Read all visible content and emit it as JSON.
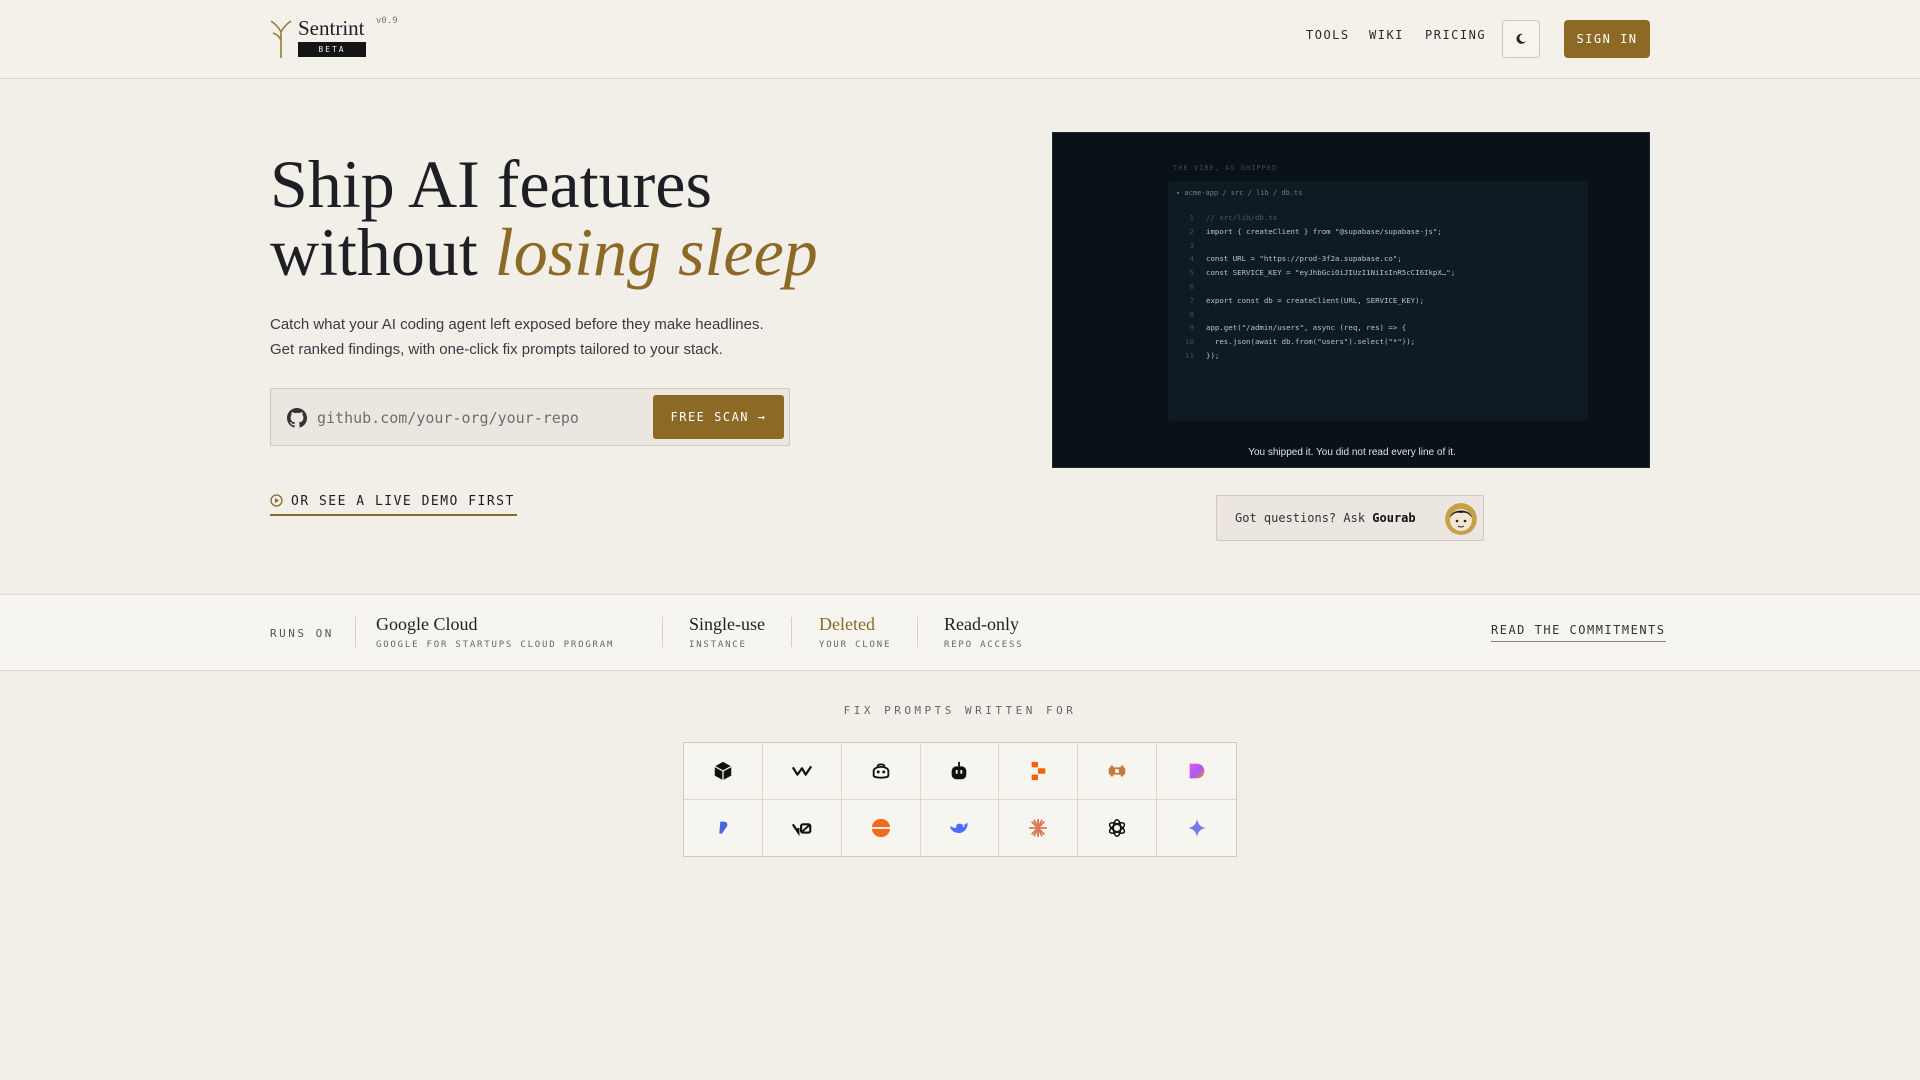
{
  "brand": {
    "name": "Sentrint",
    "version": "v0.9",
    "badge": "BETA"
  },
  "nav": {
    "tools": "TOOLS",
    "wiki": "WIKI",
    "pricing": "PRICING",
    "sign_in": "SIGN IN"
  },
  "hero": {
    "title_line1": "Ship AI features",
    "title_line2": "without",
    "title_accent": "losing sleep",
    "subtitle_line1": "Catch what your AI coding agent left exposed before they make headlines.",
    "subtitle_line2": "Get ranked findings, with one-click fix prompts tailored to your stack.",
    "repo_placeholder": "github.com/your-org/your-repo",
    "scan_button": "FREE SCAN →",
    "demo_link": "OR SEE A LIVE DEMO FIRST"
  },
  "code_panel": {
    "heading": "THE VIBE, AS SHIPPED",
    "path": "▾ acme-app / src / lib / db.ts",
    "lines": [
      "// src/lib/db.ts",
      "import { createClient } from \"@supabase/supabase-js\";",
      "",
      "const URL = \"https://prod-3f2a.supabase.co\";",
      "const SERVICE_KEY = \"eyJhbGciOiJIUzI1NiIsInR5cCI6IkpX…\";",
      "",
      "export const db = createClient(URL, SERVICE_KEY);",
      "",
      "app.get(\"/admin/users\", async (req, res) => {",
      "  res.json(await db.from(\"users\").select(\"*\"));",
      "});"
    ],
    "caption": "You shipped it. You did not read every line of it."
  },
  "ask": {
    "prefix": "Got questions? Ask",
    "name": "Gourab"
  },
  "strip": {
    "runs_on": "RUNS ON",
    "items": [
      {
        "title": "Google Cloud",
        "caption": "GOOGLE FOR STARTUPS CLOUD PROGRAM"
      },
      {
        "title": "Single-use",
        "caption": "INSTANCE"
      },
      {
        "title": "Deleted",
        "caption": "YOUR CLONE"
      },
      {
        "title": "Read-only",
        "caption": "REPO ACCESS"
      }
    ],
    "commitments": "READ THE COMMITMENTS"
  },
  "fix_prompts": {
    "title": "FIX PROMPTS WRITTEN FOR",
    "tools": [
      "cube-icon",
      "windsurf-icon",
      "copilot-icon",
      "robot-icon",
      "replit-icon",
      "bolt-icon",
      "lovable-icon",
      "base44-icon",
      "v0-icon",
      "firebase-icon",
      "deepseek-icon",
      "claude-icon",
      "openai-icon",
      "gemini-icon"
    ]
  },
  "colors": {
    "accent": "#8c6a26",
    "background": "#f2efe9",
    "code_bg": "#0a1218"
  }
}
